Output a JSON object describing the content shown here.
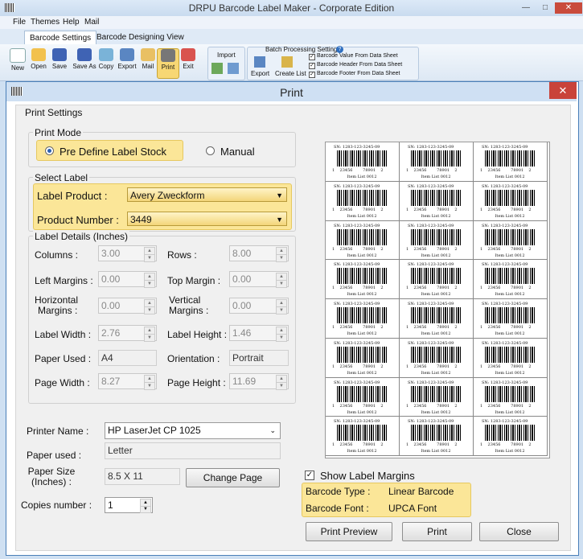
{
  "app": {
    "title": "DRPU Barcode Label Maker - Corporate Edition",
    "menu": [
      "File",
      "Themes",
      "Help",
      "Mail"
    ],
    "ribbon_tabs": [
      "Barcode Settings",
      "Barcode Designing View"
    ],
    "toolbar": [
      "New",
      "Open",
      "Save",
      "Save As",
      "Copy",
      "Export",
      "Mail",
      "Print",
      "Exit"
    ],
    "import_label": "Import",
    "batch": {
      "title": "Batch Processing Settings",
      "export": "Export",
      "create_list": "Create List",
      "options": [
        "Barcode Value From Data Sheet",
        "Barcode Header From Data Sheet",
        "Barcode Footer From Data Sheet"
      ]
    }
  },
  "dialog": {
    "title": "Print",
    "print_settings": "Print Settings",
    "print_mode": {
      "legend": "Print Mode",
      "options": [
        "Pre Define Label Stock",
        "Manual"
      ],
      "selected": "Pre Define Label Stock"
    },
    "select_label": {
      "legend": "Select Label",
      "product_label": "Label Product :",
      "product_value": "Avery Zweckform",
      "number_label": "Product Number :",
      "number_value": "3449"
    },
    "details": {
      "legend": "Label Details (Inches)",
      "columns_label": "Columns :",
      "columns": "3.00",
      "rows_label": "Rows :",
      "rows": "8.00",
      "left_margins_label": "Left Margins :",
      "left_margins": "0.00",
      "top_margin_label": "Top Margin :",
      "top_margin": "0.00",
      "hmargins_label_1": "Horizontal",
      "hmargins_label_2": "Margins :",
      "hmargins": "0.00",
      "vmargins_label_1": "Vertical",
      "vmargins_label_2": "Margins :",
      "vmargins": "0.00",
      "label_width_label": "Label Width :",
      "label_width": "2.76",
      "label_height_label": "Label Height :",
      "label_height": "1.46",
      "paper_used_label": "Paper Used :",
      "paper_used": "A4",
      "orientation_label": "Orientation :",
      "orientation": "Portrait",
      "page_width_label": "Page Width :",
      "page_width": "8.27",
      "page_height_label": "Page Height :",
      "page_height": "11.69"
    },
    "printer": {
      "name_label": "Printer Name :",
      "name": "HP LaserJet CP 1025",
      "paper_used_label": "Paper used :",
      "paper_used": "Letter",
      "paper_size_label_1": "Paper Size",
      "paper_size_label_2": "(Inches) :",
      "paper_size": "8.5 X 11",
      "change_page": "Change Page",
      "copies_label": "Copies number :",
      "copies": "1"
    },
    "show_margins": "Show Label Margins",
    "barcode_type_label": "Barcode Type :",
    "barcode_type": "Linear Barcode",
    "barcode_font_label": "Barcode Font :",
    "barcode_font": "UPCA Font",
    "buttons": {
      "preview": "Print Preview",
      "print": "Print",
      "close": "Close"
    },
    "label_sample": {
      "sn": "SN:  1283-123-3245-09",
      "digits": "1    23456        78901    2",
      "item": "Item List 0012"
    }
  },
  "colors": {
    "highlight": "#fbe698",
    "dialog_border": "#4a7fb8",
    "close_red": "#c9433a"
  }
}
